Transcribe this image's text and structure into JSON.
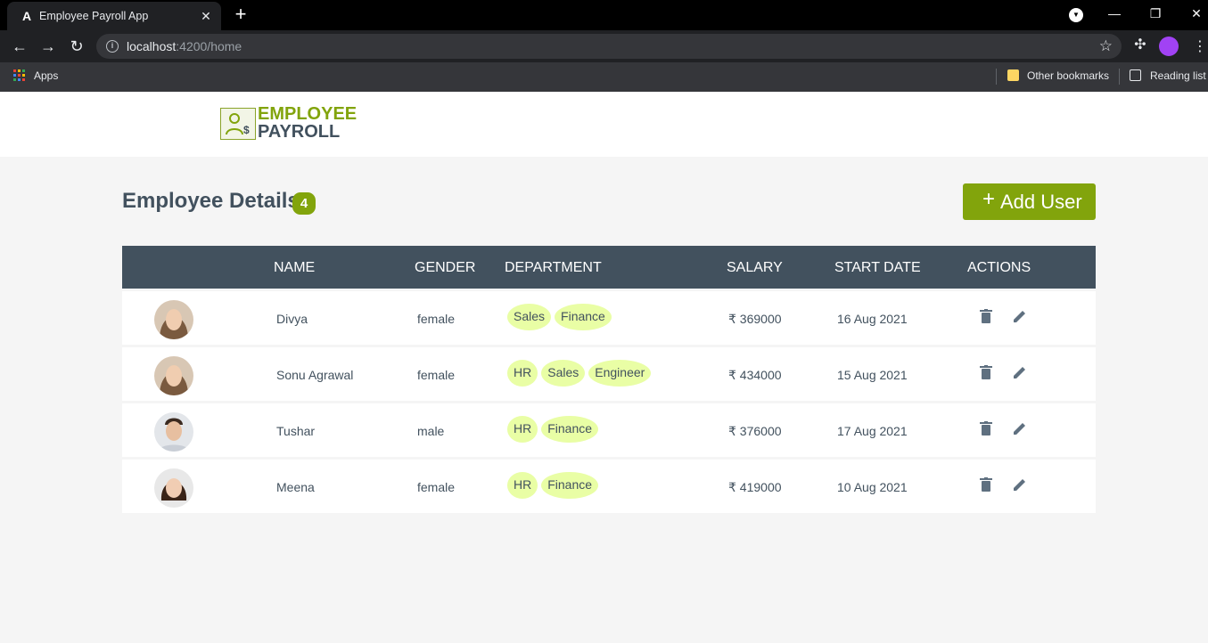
{
  "browser": {
    "tab_title": "Employee Payroll App",
    "tab_favicon": "A",
    "url_host": "localhost",
    "url_path": ":4200/home",
    "bookmarks": {
      "apps_label": "Apps",
      "other_label": "Other bookmarks",
      "reading_label": "Reading list"
    }
  },
  "header": {
    "logo_line1": "EMPLOYEE",
    "logo_line2": "PAYROLL",
    "brand_color": "#82a40c"
  },
  "main": {
    "title": "Employee Details",
    "count": "4",
    "add_button_label": "Add User"
  },
  "table": {
    "columns": [
      "NAME",
      "GENDER",
      "DEPARTMENT",
      "SALARY",
      "START DATE",
      "ACTIONS"
    ],
    "rows": [
      {
        "name": "Divya",
        "gender": "female",
        "departments": [
          "Sales",
          "Finance"
        ],
        "salary": "₹ 369000",
        "start_date": "16 Aug 2021",
        "avatar": "female-avatar"
      },
      {
        "name": "Sonu Agrawal",
        "gender": "female",
        "departments": [
          "HR",
          "Sales",
          "Engineer"
        ],
        "salary": "₹ 434000",
        "start_date": "15 Aug 2021",
        "avatar": "female-avatar"
      },
      {
        "name": "Tushar",
        "gender": "male",
        "departments": [
          "HR",
          "Finance"
        ],
        "salary": "₹ 376000",
        "start_date": "17 Aug 2021",
        "avatar": "male-avatar"
      },
      {
        "name": "Meena",
        "gender": "female",
        "departments": [
          "HR",
          "Finance"
        ],
        "salary": "₹ 419000",
        "start_date": "10 Aug 2021",
        "avatar": "female-avatar"
      }
    ]
  },
  "colors": {
    "header_bg": "#42515e",
    "chip_bg": "#e9fea5",
    "accent": "#82a40c"
  }
}
